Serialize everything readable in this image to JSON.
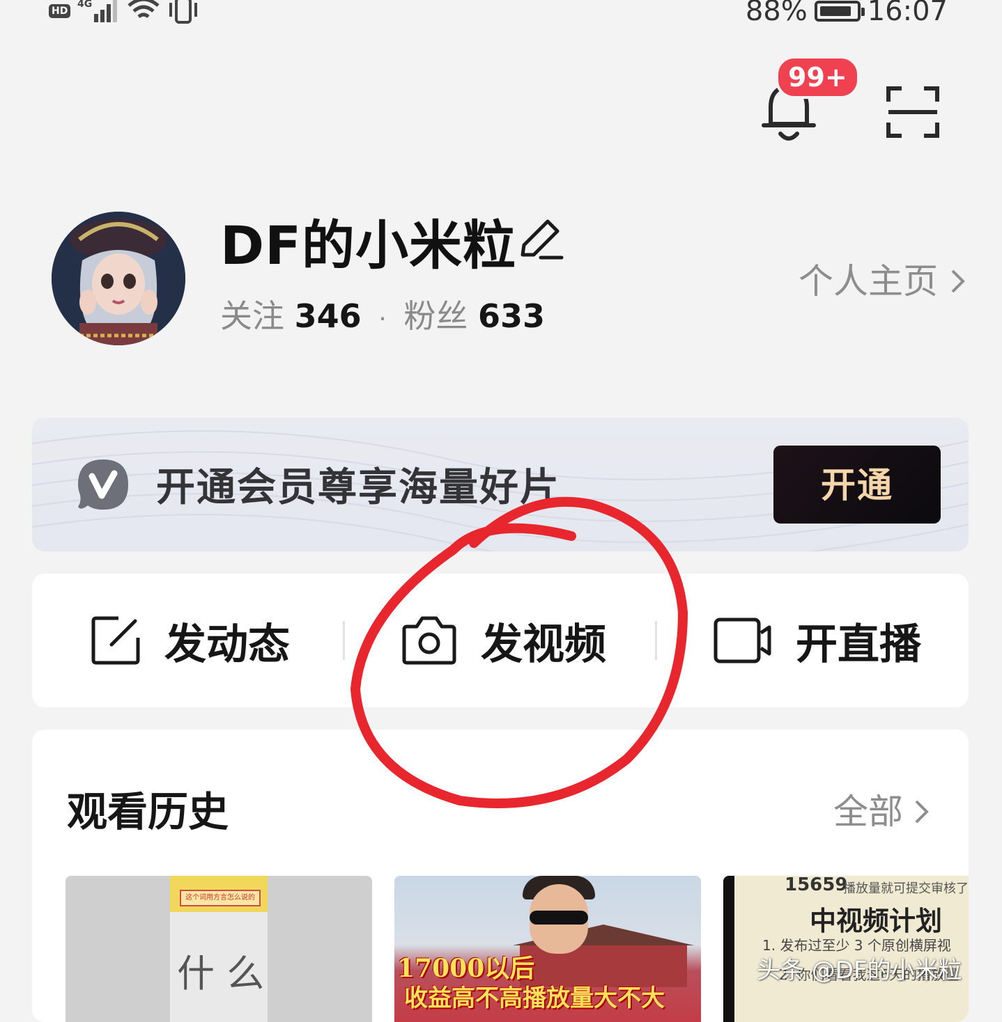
{
  "status_bar": {
    "hd": "HD",
    "network": "4G",
    "battery_text": "88%",
    "battery_level": 0.88,
    "time": "16:07"
  },
  "top_bar": {
    "notification_badge": "99+"
  },
  "profile": {
    "username": "DF的小米粒",
    "following_label": "关注",
    "following_count": "346",
    "separator": "·",
    "followers_label": "粉丝",
    "followers_count": "633",
    "homepage_link": "个人主页"
  },
  "vip_banner": {
    "text": "开通会员尊享海量好片",
    "button_label": "开通"
  },
  "actions": [
    {
      "label": "发动态",
      "icon": "edit-post-icon"
    },
    {
      "label": "发视频",
      "icon": "camera-icon"
    },
    {
      "label": "开直播",
      "icon": "live-video-icon"
    }
  ],
  "history": {
    "title": "观看历史",
    "all_link": "全部",
    "items": [
      {
        "tag": "这个词用方言怎么说的",
        "text": "什 么"
      },
      {
        "line1": "17000以后",
        "line2": "收益高不高播放量大不大"
      },
      {
        "number": "15659",
        "sub": "播放量就可提交审核了",
        "title": "中视频计划",
        "line1": "1. 发布过至少 3 个原创横屏视",
        "line2": "2. 你们看看我这6天的播放量"
      }
    ]
  },
  "watermark": "头条 @DF的小米粒",
  "colors": {
    "accent_red": "#f04150",
    "annotation_red": "#e8262d",
    "vip_button_text": "#f5d6aa"
  }
}
